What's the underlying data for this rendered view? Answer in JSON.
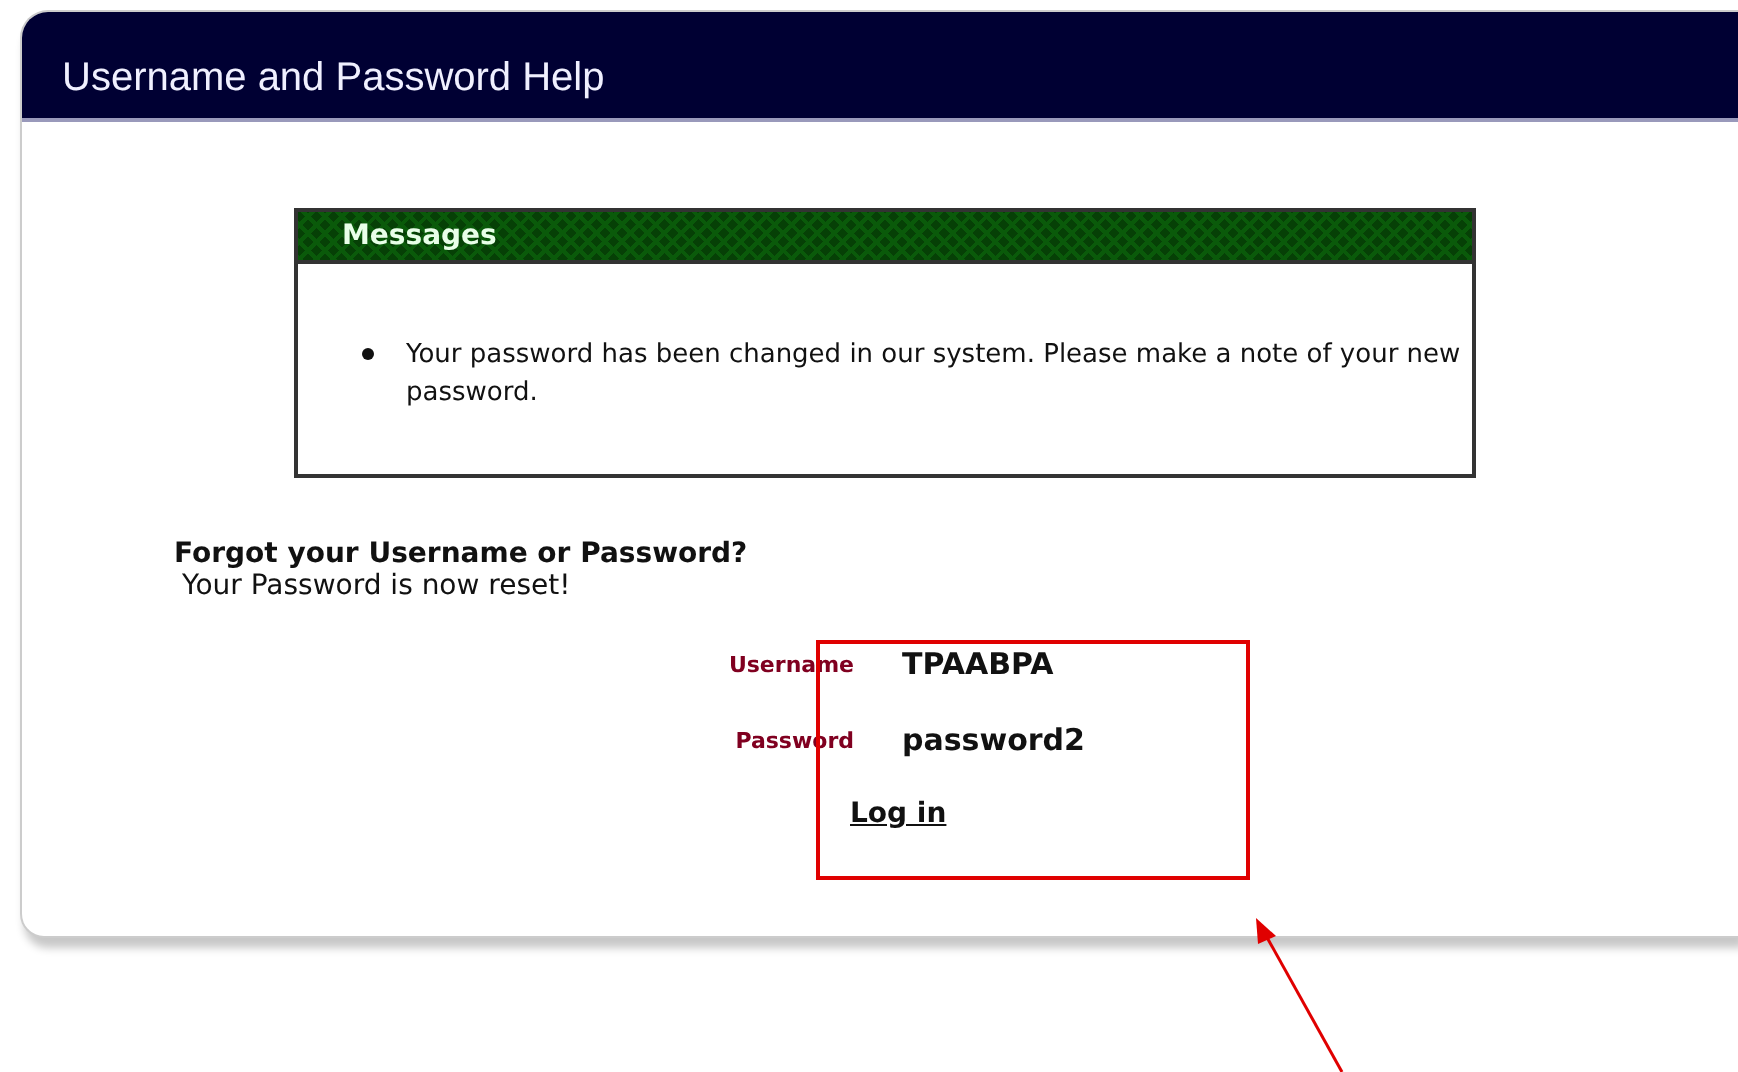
{
  "window": {
    "title": "Username and Password Help"
  },
  "messages": {
    "title": "Messages",
    "items": [
      "Your password has been changed in our system. Please make a note of your new password."
    ]
  },
  "forgot": {
    "heading": "Forgot your Username or Password?",
    "status": "Your Password is now reset!"
  },
  "fields": [
    {
      "label": "Username",
      "value": "TPAABPA"
    },
    {
      "label": "Password",
      "value": "password2"
    }
  ],
  "link": "Log in"
}
